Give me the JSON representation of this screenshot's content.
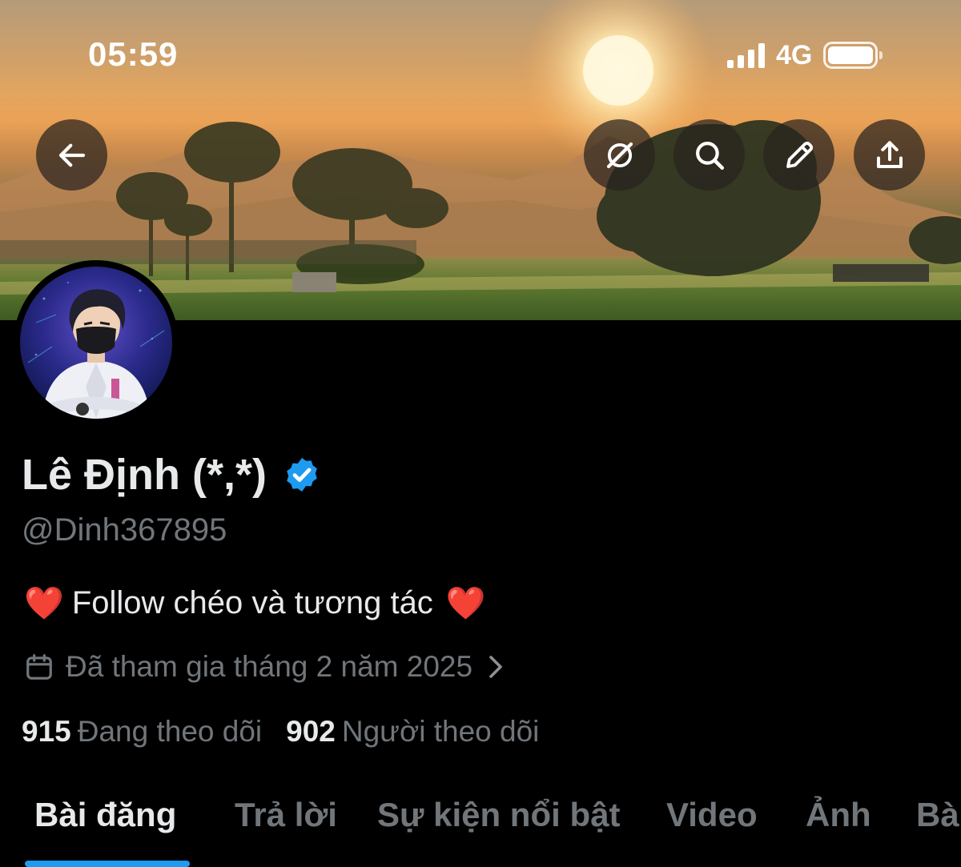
{
  "status_bar": {
    "time": "05:59",
    "network": "4G"
  },
  "header_buttons": [
    {
      "name": "back",
      "icon": "arrow-left-icon"
    },
    {
      "name": "grok",
      "icon": "grok-icon"
    },
    {
      "name": "search",
      "icon": "search-icon"
    },
    {
      "name": "edit",
      "icon": "pencil-icon"
    },
    {
      "name": "share",
      "icon": "share-icon"
    }
  ],
  "profile": {
    "display_name": "Lê Định (*,*)",
    "handle": "@Dinh367895",
    "verified": true,
    "bio_text": "Follow chéo và tương tác",
    "bio_emoji": "❤️",
    "joined": "Đã tham gia tháng 2 năm 2025"
  },
  "stats": {
    "following_count": "915",
    "following_label": "Đang theo dõi",
    "followers_count": "902",
    "followers_label": "Người theo dõi"
  },
  "tabs": [
    "Bài đăng",
    "Trả lời",
    "Sự kiện nổi bật",
    "Video",
    "Ảnh",
    "Bà"
  ],
  "active_tab": "Bài đăng",
  "colors": {
    "background": "#000000",
    "accent": "#1d9bf0",
    "text_primary": "#e7e9ea",
    "text_secondary": "#71767b",
    "verified_badge": "#1d9bf0"
  }
}
